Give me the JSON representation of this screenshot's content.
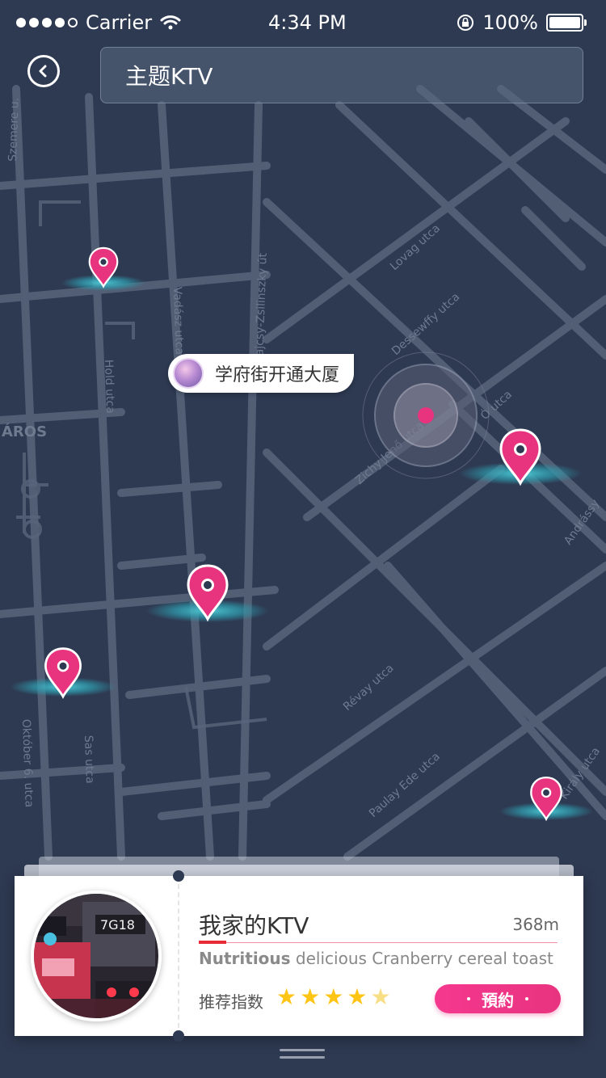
{
  "status_bar": {
    "carrier": "Carrier",
    "time": "4:34 PM",
    "battery": "100%",
    "battery_level": 1.0,
    "signal_bars_filled": 4,
    "signal_bars_total": 5
  },
  "header": {
    "search_value": "主题KTV",
    "back_icon": "back-icon"
  },
  "map": {
    "street_labels": [
      "Szemere u.",
      "Vadász utca",
      "Hold utca",
      "ÁROS",
      "Lovag utca",
      "Dessewffy utca",
      "Bajcsy-Zsilinszky út",
      "Zichy Jenő utca",
      "Ó utca",
      "Andrássy",
      "Révay utca",
      "Paulay Ede utca",
      "Király utca",
      "Sas utca",
      "Október 6. utca"
    ],
    "current_location_label": "学府街开通大厦"
  },
  "card": {
    "title": "我家的KTV",
    "distance": "368m",
    "desc_bold": "Nutritious",
    "desc_rest": " delicious Cranberry cereal toast",
    "rating_label": "推荐指数",
    "rating": 4,
    "rating_max": 5,
    "book_label": "預約",
    "photo_sign": "7G18"
  },
  "colors": {
    "background": "#2e3a52",
    "road": "#58657b",
    "pin": "#e8337f",
    "pin_base": "#38b3c1",
    "accent_red": "#e82c37",
    "star": "#ffc515"
  }
}
